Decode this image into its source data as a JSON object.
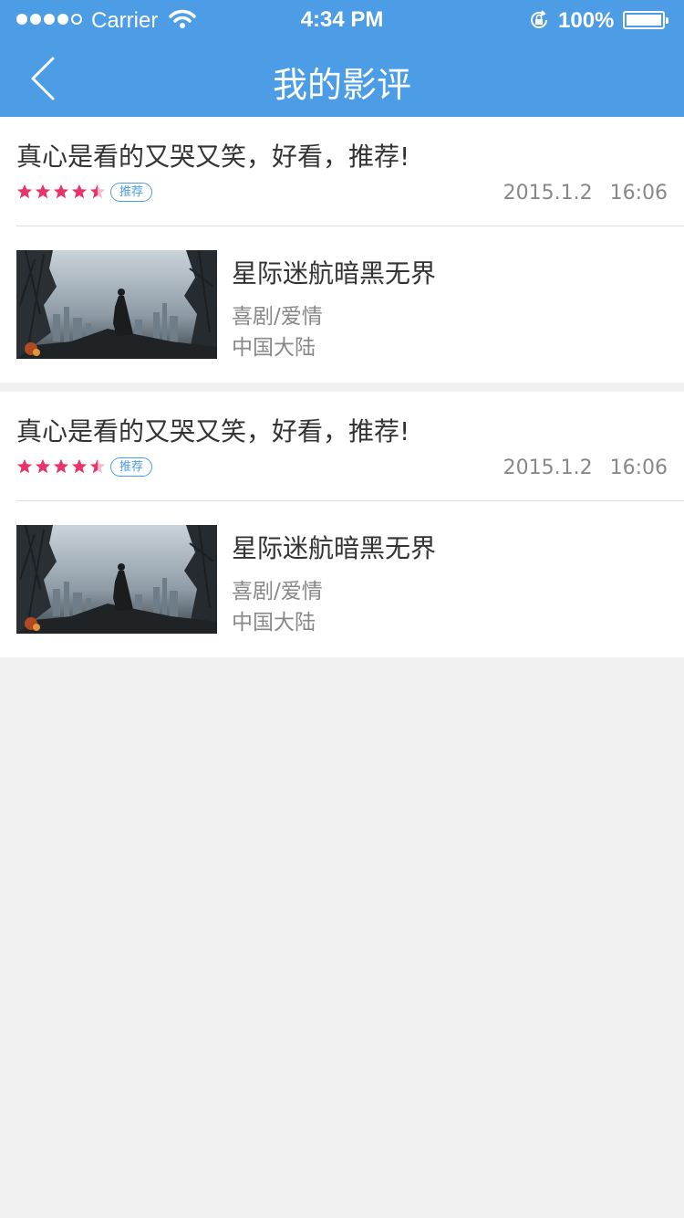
{
  "status_bar": {
    "carrier": "Carrier",
    "time": "4:34 PM",
    "battery": "100%",
    "icons": [
      "signal-dots",
      "wifi-icon",
      "rotation-lock-icon",
      "battery-icon"
    ]
  },
  "nav": {
    "title": "我的影评",
    "back_icon": "chevron-left-icon"
  },
  "colors": {
    "primary": "#4d9de6",
    "star": "#e8336b",
    "background": "#f0f0f0"
  },
  "reviews": [
    {
      "text": "真心是看的又哭又笑，好看，推荐!",
      "rating": 4.5,
      "rating_max": 5,
      "badge": "推荐",
      "date": "2015.1.2",
      "time": "16:06",
      "movie": {
        "title": "星际迷航暗黑无界",
        "genre": "喜剧/爱情",
        "region": "中国大陆"
      }
    },
    {
      "text": "真心是看的又哭又笑，好看，推荐!",
      "rating": 4.5,
      "rating_max": 5,
      "badge": "推荐",
      "date": "2015.1.2",
      "time": "16:06",
      "movie": {
        "title": "星际迷航暗黑无界",
        "genre": "喜剧/爱情",
        "region": "中国大陆"
      }
    }
  ]
}
